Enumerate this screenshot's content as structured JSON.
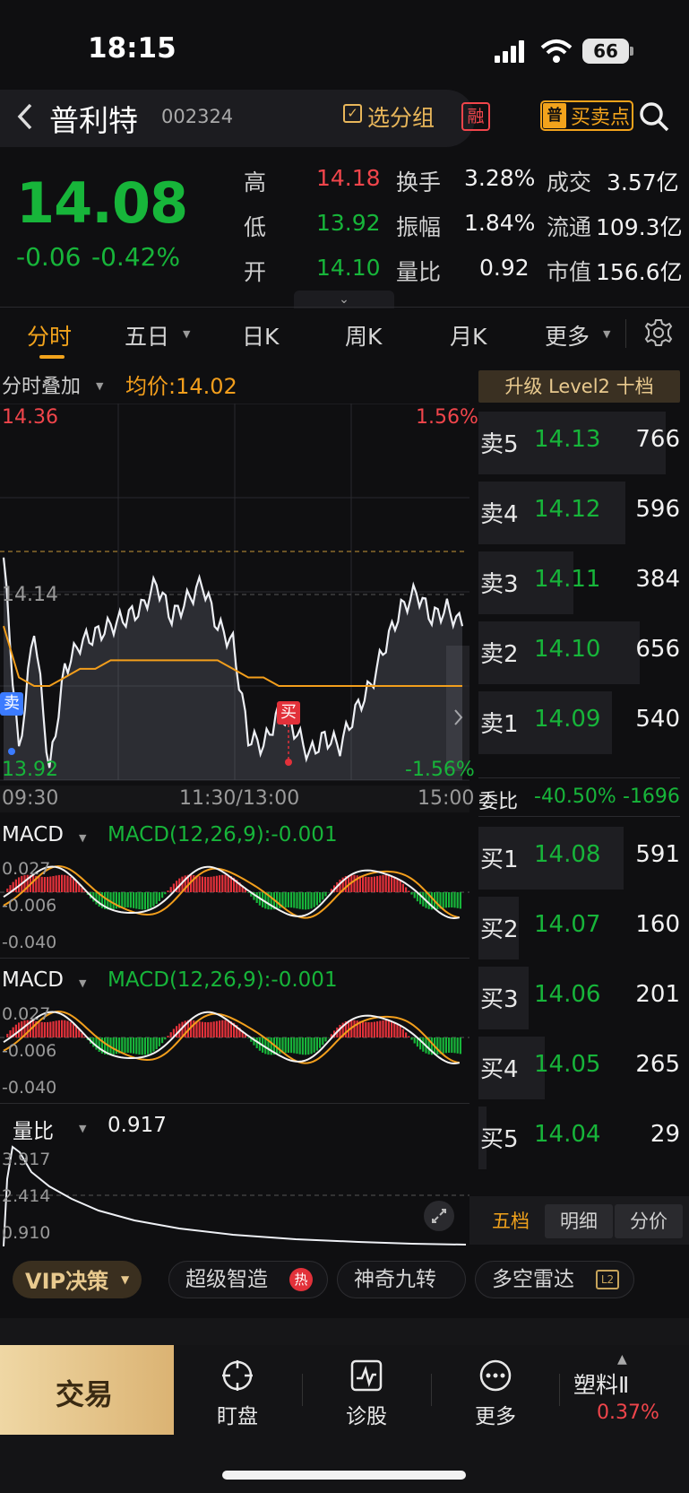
{
  "status_bar": {
    "time": "18:15",
    "battery": "66"
  },
  "header": {
    "back_icon": "chevron-left-icon",
    "stock_name": "普利特",
    "stock_code": "002324",
    "group_label": "选分组",
    "rong_badge": "融",
    "bsp_icon_char": "普",
    "bsp_label": "买卖点"
  },
  "quote": {
    "price": "14.08",
    "change": "-0.06",
    "change_pct": "-0.42%",
    "fields": [
      {
        "k1": "高",
        "v1": "14.18",
        "k2": "换手",
        "v2": "3.28%",
        "k3": "成交",
        "v3": "3.57亿"
      },
      {
        "k1": "低",
        "v1": "13.92",
        "k2": "振幅",
        "v2": "1.84%",
        "k3": "流通",
        "v3": "109.3亿"
      },
      {
        "k1": "开",
        "v1": "14.10",
        "k2": "量比",
        "v2": "0.92",
        "k3": "市值",
        "v3": "156.6亿"
      }
    ],
    "colors": {
      "high": "#f0454b",
      "low": "#17b53a",
      "open": "#17b53a"
    }
  },
  "tabs": [
    "分时",
    "五日",
    "日K",
    "周K",
    "月K",
    "更多"
  ],
  "intraday": {
    "overlay_label": "分时叠加",
    "avg_label": "均价:14.02",
    "y_high": "14.36",
    "y_high_pct": "1.56%",
    "y_mid": "14.14",
    "y_low": "13.92",
    "y_low_pct": "-1.56%",
    "time_start": "09:30",
    "time_mid": "11:30/13:00",
    "time_end": "15:00",
    "sell_marker": "卖",
    "buy_marker": "买"
  },
  "chart_data": [
    {
      "type": "line",
      "ylim": [
        13.92,
        14.36
      ],
      "series": [
        {
          "values": [
            14.18,
            13.95,
            14.1,
            13.93,
            14.05,
            14.08,
            14.09,
            14.1,
            14.11,
            14.12,
            14.15,
            14.11,
            14.13,
            14.15,
            14.1,
            14.08,
            13.97,
            13.96,
            14.0,
            13.98,
            13.95,
            13.97,
            13.96,
            14.0,
            14.03,
            14.08,
            14.12,
            14.14,
            14.11,
            14.12,
            14.1
          ]
        },
        {
          "values": [
            14.1,
            14.04,
            14.03,
            14.03,
            14.04,
            14.05,
            14.05,
            14.06,
            14.06,
            14.06,
            14.06,
            14.06,
            14.06,
            14.06,
            14.06,
            14.05,
            14.04,
            14.04,
            14.03,
            14.03,
            14.03,
            14.03,
            14.03,
            14.03,
            14.03,
            14.03,
            14.03,
            14.03,
            14.03,
            14.03,
            14.03
          ]
        }
      ]
    },
    {
      "type": "bar",
      "title": "MACD(12,26,9):-0.001",
      "ylim": [
        -0.04,
        0.027
      ],
      "ticks": [
        "0.027",
        "-0.006",
        "-0.040"
      ]
    },
    {
      "type": "line",
      "title": "量比",
      "value": "0.917",
      "ticks": [
        "3.917",
        "2.414",
        "0.910"
      ]
    }
  ],
  "macd": {
    "label": "MACD",
    "formula": "MACD(12,26,9):-0.001",
    "tick_top": "0.027",
    "tick_mid": "-0.006",
    "tick_bot": "-0.040"
  },
  "volume_ratio": {
    "label": "量比",
    "value": "0.917",
    "tick_top": "3.917",
    "tick_mid": "2.414",
    "tick_bot": "0.910"
  },
  "order_book": {
    "upgrade": "升级 Level2 十档",
    "sells": [
      {
        "label": "卖5",
        "price": "14.13",
        "vol": "766",
        "bar": 0.93
      },
      {
        "label": "卖4",
        "price": "14.12",
        "vol": "596",
        "bar": 0.73
      },
      {
        "label": "卖3",
        "price": "14.11",
        "vol": "384",
        "bar": 0.47
      },
      {
        "label": "卖2",
        "price": "14.10",
        "vol": "656",
        "bar": 0.8
      },
      {
        "label": "卖1",
        "price": "14.09",
        "vol": "540",
        "bar": 0.66
      }
    ],
    "weibi_label": "委比",
    "weibi_pct": "-40.50%",
    "weibi_vol": "-1696",
    "buys": [
      {
        "label": "买1",
        "price": "14.08",
        "vol": "591",
        "bar": 0.72
      },
      {
        "label": "买2",
        "price": "14.07",
        "vol": "160",
        "bar": 0.2
      },
      {
        "label": "买3",
        "price": "14.06",
        "vol": "201",
        "bar": 0.25
      },
      {
        "label": "买4",
        "price": "14.05",
        "vol": "265",
        "bar": 0.33
      },
      {
        "label": "买5",
        "price": "14.04",
        "vol": "29",
        "bar": 0.04
      }
    ],
    "tabs": [
      "五档",
      "明细",
      "分价"
    ]
  },
  "chips": {
    "vip": "VIP决策",
    "items": [
      "超级智造",
      "神奇九转",
      "多空雷达"
    ],
    "hot": "热",
    "l2": "L2"
  },
  "bottom_nav": {
    "trade": "交易",
    "items": [
      {
        "label": "盯盘",
        "icon": "crosshair-icon"
      },
      {
        "label": "诊股",
        "icon": "pulse-chart-icon"
      },
      {
        "label": "更多",
        "icon": "more-dots-icon"
      }
    ],
    "sector_name": "塑料Ⅱ",
    "sector_pct": "0.37%"
  }
}
